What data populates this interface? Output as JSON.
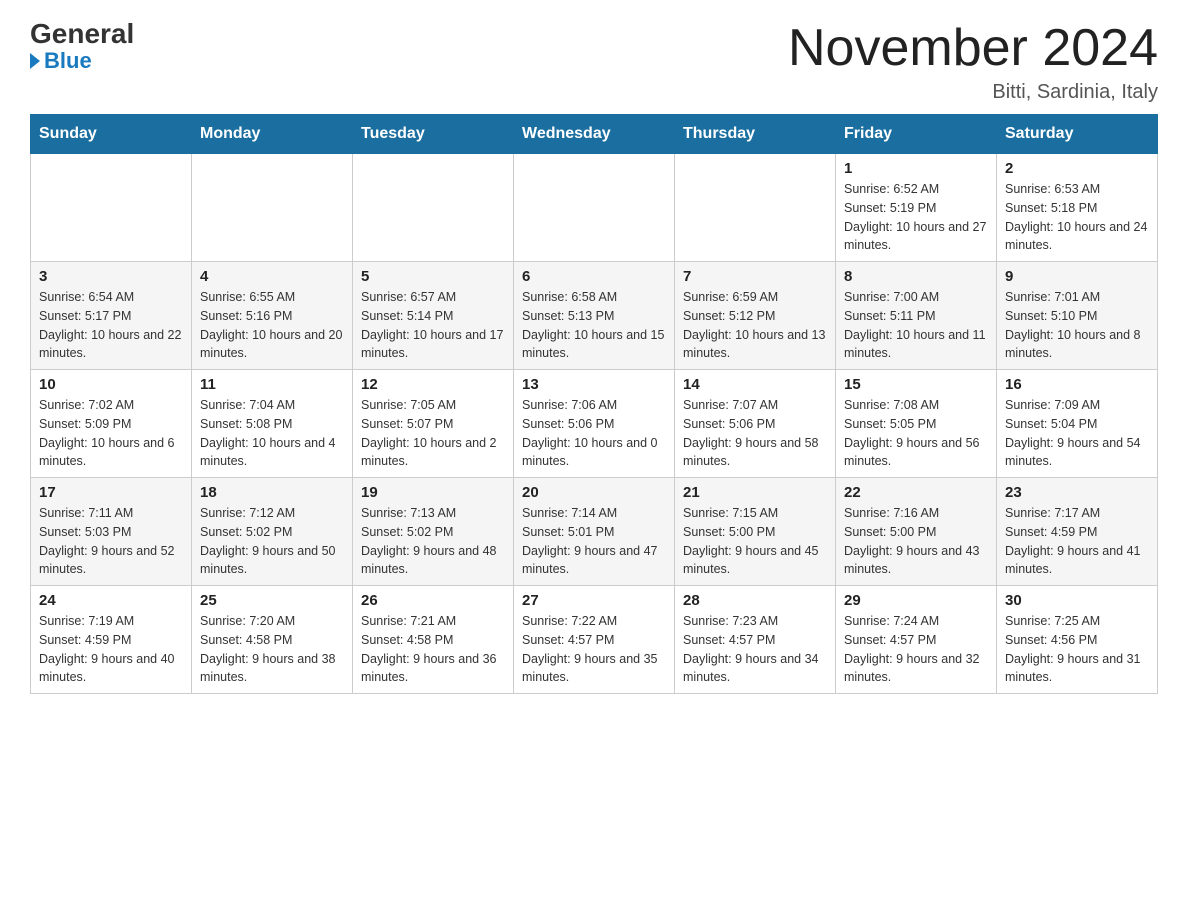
{
  "header": {
    "logo_general": "General",
    "logo_blue": "Blue",
    "month_title": "November 2024",
    "location": "Bitti, Sardinia, Italy"
  },
  "days_of_week": [
    "Sunday",
    "Monday",
    "Tuesday",
    "Wednesday",
    "Thursday",
    "Friday",
    "Saturday"
  ],
  "weeks": [
    [
      {
        "day": "",
        "info": ""
      },
      {
        "day": "",
        "info": ""
      },
      {
        "day": "",
        "info": ""
      },
      {
        "day": "",
        "info": ""
      },
      {
        "day": "",
        "info": ""
      },
      {
        "day": "1",
        "info": "Sunrise: 6:52 AM\nSunset: 5:19 PM\nDaylight: 10 hours and 27 minutes."
      },
      {
        "day": "2",
        "info": "Sunrise: 6:53 AM\nSunset: 5:18 PM\nDaylight: 10 hours and 24 minutes."
      }
    ],
    [
      {
        "day": "3",
        "info": "Sunrise: 6:54 AM\nSunset: 5:17 PM\nDaylight: 10 hours and 22 minutes."
      },
      {
        "day": "4",
        "info": "Sunrise: 6:55 AM\nSunset: 5:16 PM\nDaylight: 10 hours and 20 minutes."
      },
      {
        "day": "5",
        "info": "Sunrise: 6:57 AM\nSunset: 5:14 PM\nDaylight: 10 hours and 17 minutes."
      },
      {
        "day": "6",
        "info": "Sunrise: 6:58 AM\nSunset: 5:13 PM\nDaylight: 10 hours and 15 minutes."
      },
      {
        "day": "7",
        "info": "Sunrise: 6:59 AM\nSunset: 5:12 PM\nDaylight: 10 hours and 13 minutes."
      },
      {
        "day": "8",
        "info": "Sunrise: 7:00 AM\nSunset: 5:11 PM\nDaylight: 10 hours and 11 minutes."
      },
      {
        "day": "9",
        "info": "Sunrise: 7:01 AM\nSunset: 5:10 PM\nDaylight: 10 hours and 8 minutes."
      }
    ],
    [
      {
        "day": "10",
        "info": "Sunrise: 7:02 AM\nSunset: 5:09 PM\nDaylight: 10 hours and 6 minutes."
      },
      {
        "day": "11",
        "info": "Sunrise: 7:04 AM\nSunset: 5:08 PM\nDaylight: 10 hours and 4 minutes."
      },
      {
        "day": "12",
        "info": "Sunrise: 7:05 AM\nSunset: 5:07 PM\nDaylight: 10 hours and 2 minutes."
      },
      {
        "day": "13",
        "info": "Sunrise: 7:06 AM\nSunset: 5:06 PM\nDaylight: 10 hours and 0 minutes."
      },
      {
        "day": "14",
        "info": "Sunrise: 7:07 AM\nSunset: 5:06 PM\nDaylight: 9 hours and 58 minutes."
      },
      {
        "day": "15",
        "info": "Sunrise: 7:08 AM\nSunset: 5:05 PM\nDaylight: 9 hours and 56 minutes."
      },
      {
        "day": "16",
        "info": "Sunrise: 7:09 AM\nSunset: 5:04 PM\nDaylight: 9 hours and 54 minutes."
      }
    ],
    [
      {
        "day": "17",
        "info": "Sunrise: 7:11 AM\nSunset: 5:03 PM\nDaylight: 9 hours and 52 minutes."
      },
      {
        "day": "18",
        "info": "Sunrise: 7:12 AM\nSunset: 5:02 PM\nDaylight: 9 hours and 50 minutes."
      },
      {
        "day": "19",
        "info": "Sunrise: 7:13 AM\nSunset: 5:02 PM\nDaylight: 9 hours and 48 minutes."
      },
      {
        "day": "20",
        "info": "Sunrise: 7:14 AM\nSunset: 5:01 PM\nDaylight: 9 hours and 47 minutes."
      },
      {
        "day": "21",
        "info": "Sunrise: 7:15 AM\nSunset: 5:00 PM\nDaylight: 9 hours and 45 minutes."
      },
      {
        "day": "22",
        "info": "Sunrise: 7:16 AM\nSunset: 5:00 PM\nDaylight: 9 hours and 43 minutes."
      },
      {
        "day": "23",
        "info": "Sunrise: 7:17 AM\nSunset: 4:59 PM\nDaylight: 9 hours and 41 minutes."
      }
    ],
    [
      {
        "day": "24",
        "info": "Sunrise: 7:19 AM\nSunset: 4:59 PM\nDaylight: 9 hours and 40 minutes."
      },
      {
        "day": "25",
        "info": "Sunrise: 7:20 AM\nSunset: 4:58 PM\nDaylight: 9 hours and 38 minutes."
      },
      {
        "day": "26",
        "info": "Sunrise: 7:21 AM\nSunset: 4:58 PM\nDaylight: 9 hours and 36 minutes."
      },
      {
        "day": "27",
        "info": "Sunrise: 7:22 AM\nSunset: 4:57 PM\nDaylight: 9 hours and 35 minutes."
      },
      {
        "day": "28",
        "info": "Sunrise: 7:23 AM\nSunset: 4:57 PM\nDaylight: 9 hours and 34 minutes."
      },
      {
        "day": "29",
        "info": "Sunrise: 7:24 AM\nSunset: 4:57 PM\nDaylight: 9 hours and 32 minutes."
      },
      {
        "day": "30",
        "info": "Sunrise: 7:25 AM\nSunset: 4:56 PM\nDaylight: 9 hours and 31 minutes."
      }
    ]
  ]
}
